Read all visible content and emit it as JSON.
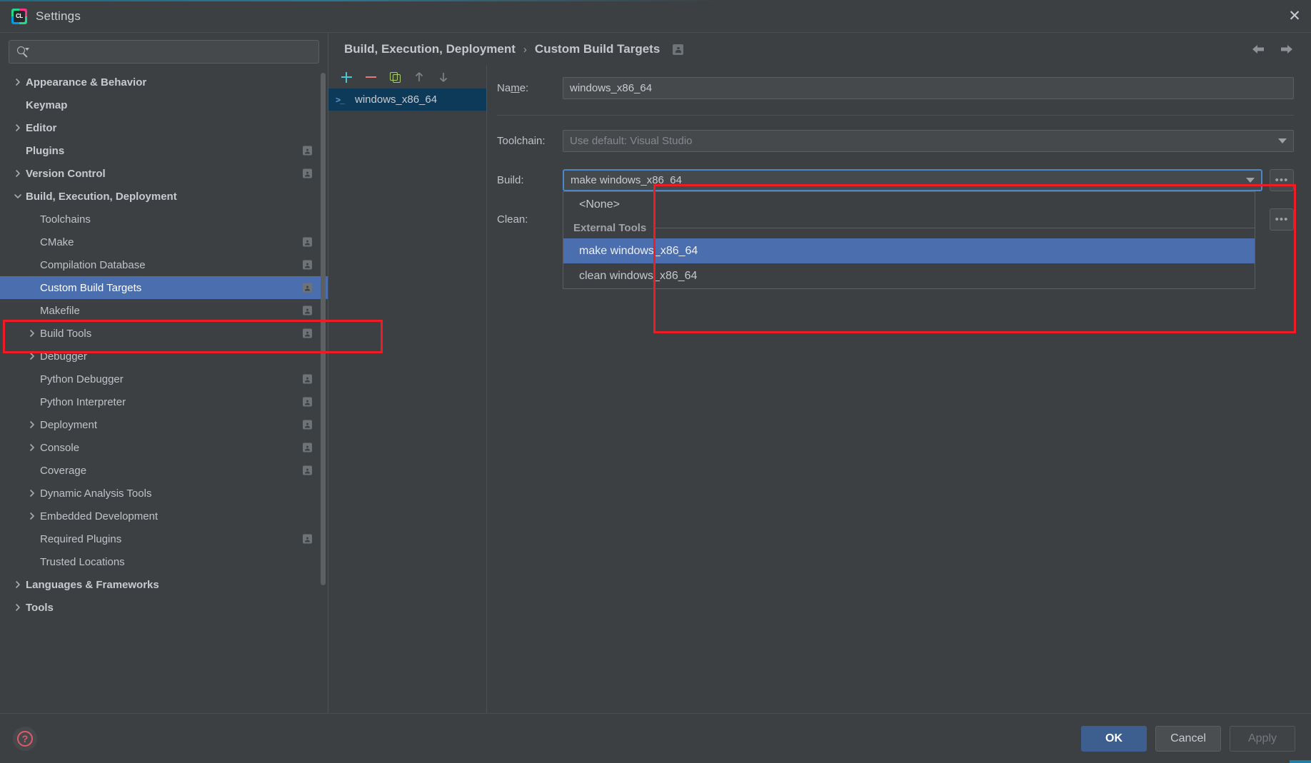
{
  "window": {
    "title": "Settings",
    "app_icon": "clion-logo-icon",
    "close_label": "✕"
  },
  "search": {
    "value": "",
    "placeholder": "",
    "icon": "search-icon"
  },
  "sidebar": {
    "items": [
      {
        "label": "Appearance & Behavior",
        "level": 0,
        "twisty": "collapsed",
        "badge": false,
        "selected": false
      },
      {
        "label": "Keymap",
        "level": 0,
        "twisty": "none",
        "badge": false,
        "selected": false
      },
      {
        "label": "Editor",
        "level": 0,
        "twisty": "collapsed",
        "badge": false,
        "selected": false
      },
      {
        "label": "Plugins",
        "level": 0,
        "twisty": "none",
        "badge": true,
        "selected": false
      },
      {
        "label": "Version Control",
        "level": 0,
        "twisty": "collapsed",
        "badge": true,
        "selected": false
      },
      {
        "label": "Build, Execution, Deployment",
        "level": 0,
        "twisty": "expanded",
        "badge": false,
        "selected": false
      },
      {
        "label": "Toolchains",
        "level": 1,
        "twisty": "none",
        "badge": false,
        "selected": false
      },
      {
        "label": "CMake",
        "level": 1,
        "twisty": "none",
        "badge": true,
        "selected": false
      },
      {
        "label": "Compilation Database",
        "level": 1,
        "twisty": "none",
        "badge": true,
        "selected": false
      },
      {
        "label": "Custom Build Targets",
        "level": 1,
        "twisty": "none",
        "badge": true,
        "selected": true
      },
      {
        "label": "Makefile",
        "level": 1,
        "twisty": "none",
        "badge": true,
        "selected": false
      },
      {
        "label": "Build Tools",
        "level": 1,
        "twisty": "collapsed",
        "badge": true,
        "selected": false
      },
      {
        "label": "Debugger",
        "level": 1,
        "twisty": "collapsed",
        "badge": false,
        "selected": false
      },
      {
        "label": "Python Debugger",
        "level": 1,
        "twisty": "none",
        "badge": true,
        "selected": false
      },
      {
        "label": "Python Interpreter",
        "level": 1,
        "twisty": "none",
        "badge": true,
        "selected": false
      },
      {
        "label": "Deployment",
        "level": 1,
        "twisty": "collapsed",
        "badge": true,
        "selected": false
      },
      {
        "label": "Console",
        "level": 1,
        "twisty": "collapsed",
        "badge": true,
        "selected": false
      },
      {
        "label": "Coverage",
        "level": 1,
        "twisty": "none",
        "badge": true,
        "selected": false
      },
      {
        "label": "Dynamic Analysis Tools",
        "level": 1,
        "twisty": "collapsed",
        "badge": false,
        "selected": false
      },
      {
        "label": "Embedded Development",
        "level": 1,
        "twisty": "collapsed",
        "badge": false,
        "selected": false
      },
      {
        "label": "Required Plugins",
        "level": 1,
        "twisty": "none",
        "badge": true,
        "selected": false
      },
      {
        "label": "Trusted Locations",
        "level": 1,
        "twisty": "none",
        "badge": false,
        "selected": false
      },
      {
        "label": "Languages & Frameworks",
        "level": 0,
        "twisty": "collapsed",
        "badge": false,
        "selected": false
      },
      {
        "label": "Tools",
        "level": 0,
        "twisty": "collapsed",
        "badge": false,
        "selected": false
      }
    ]
  },
  "breadcrumb": {
    "parent": "Build, Execution, Deployment",
    "separator": "›",
    "current": "Custom Build Targets",
    "scope_badge_icon": "project-scope-icon",
    "back_icon": "arrow-left-icon",
    "forward_icon": "arrow-right-icon"
  },
  "targets": {
    "toolbar": {
      "add": "+",
      "remove": "−",
      "copy": "copy-icon",
      "move_up": "arrow-up-icon",
      "move_down": "arrow-down-icon"
    },
    "items": [
      {
        "label": "windows_x86_64",
        "icon": "terminal-icon",
        "selected": true
      }
    ]
  },
  "form": {
    "name_label": "Name:",
    "name_mnemonic": "m",
    "name_value": "windows_x86_64",
    "toolchain_label": "Toolchain:",
    "toolchain_value": "Use default: Visual Studio",
    "build_label": "Build:",
    "build_value": "make windows_x86_64",
    "clean_label": "Clean:",
    "clean_value": "",
    "browse_label": "•••"
  },
  "dropdown": {
    "open": true,
    "items": [
      {
        "label": "<None>",
        "type": "item",
        "selected": false
      },
      {
        "label": "External Tools",
        "type": "separator",
        "selected": false
      },
      {
        "label": "make windows_x86_64",
        "type": "item",
        "selected": true
      },
      {
        "label": "clean windows_x86_64",
        "type": "item",
        "selected": false
      }
    ]
  },
  "footer": {
    "help_icon": "help-question-icon",
    "ok_label": "OK",
    "cancel_label": "Cancel",
    "apply_label": "Apply",
    "apply_disabled": true
  },
  "colors": {
    "accent_blue": "#4b6eaf",
    "annotation_red": "#ee1c25",
    "window_bg": "#3c4043",
    "selection_blue": "#0d3a58",
    "primary_button": "#3c5f8f"
  }
}
